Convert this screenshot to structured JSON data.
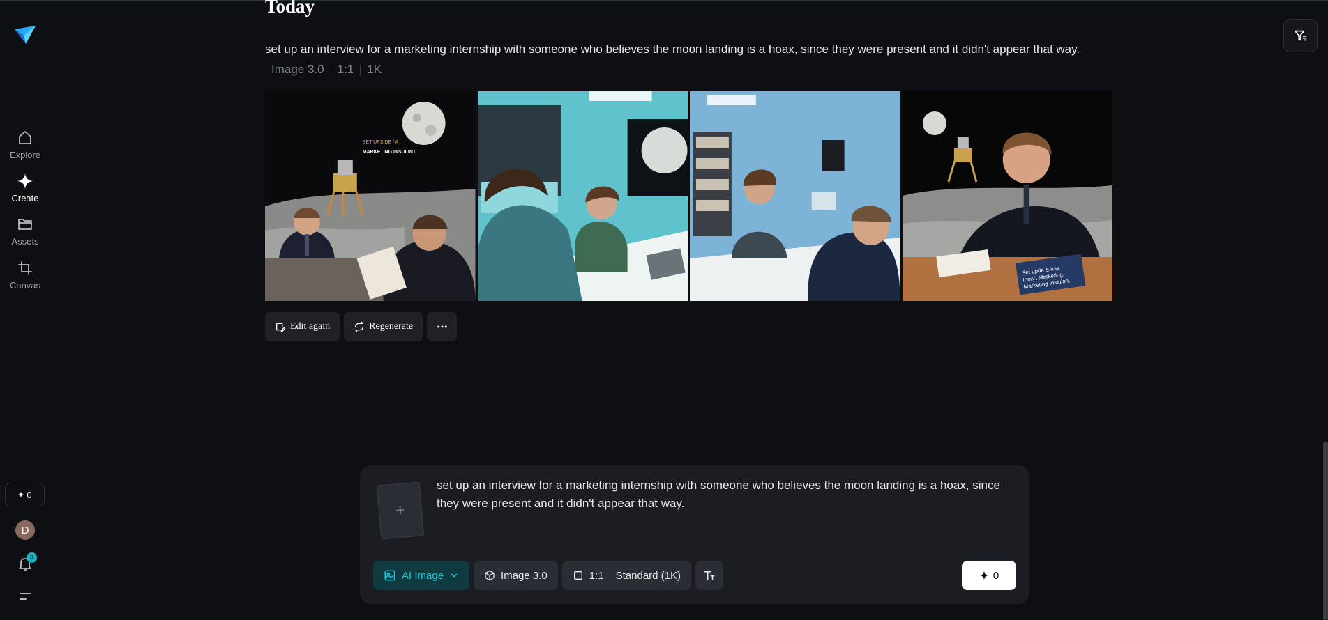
{
  "sidebar": {
    "nav": [
      {
        "label": "Explore",
        "icon": "home-icon"
      },
      {
        "label": "Create",
        "icon": "sparkle-icon"
      },
      {
        "label": "Assets",
        "icon": "folder-icon"
      },
      {
        "label": "Canvas",
        "icon": "crop-icon"
      }
    ],
    "credits": "0",
    "avatar_initial": "D",
    "notifications": "3"
  },
  "feed": {
    "section_title": "Today",
    "prompt": "set up an interview for a marketing internship with someone who believes the moon landing is a hoax, since they were present and it didn't appear that way.",
    "meta": [
      "Image 3.0",
      "1:1",
      "1K"
    ],
    "images": [
      {
        "name": "generated-image-1",
        "sign_lines": [
          "SET UPSIDE / A",
          "MARKETING INSULINT."
        ]
      },
      {
        "name": "generated-image-2",
        "sign_lines": []
      },
      {
        "name": "generated-image-3",
        "sign_lines": []
      },
      {
        "name": "generated-image-4",
        "sign_lines": [
          "Set upde & tow",
          "Inow't Marketing.",
          "Marketing Insluion."
        ]
      }
    ],
    "actions": {
      "edit_again": "Edit again",
      "regenerate": "Regenerate"
    }
  },
  "composer": {
    "text": "set up an interview for a marketing internship with someone who believes the moon landing is a hoax, since they were present and it didn't appear that way.",
    "mode": "AI Image",
    "model": "Image 3.0",
    "ratio": "1:1",
    "quality": "Standard (1K)",
    "generate_cost": "0"
  },
  "colors": {
    "accent": "#1fc8d8",
    "background": "#0e0f12",
    "panel": "#1b1d22"
  }
}
